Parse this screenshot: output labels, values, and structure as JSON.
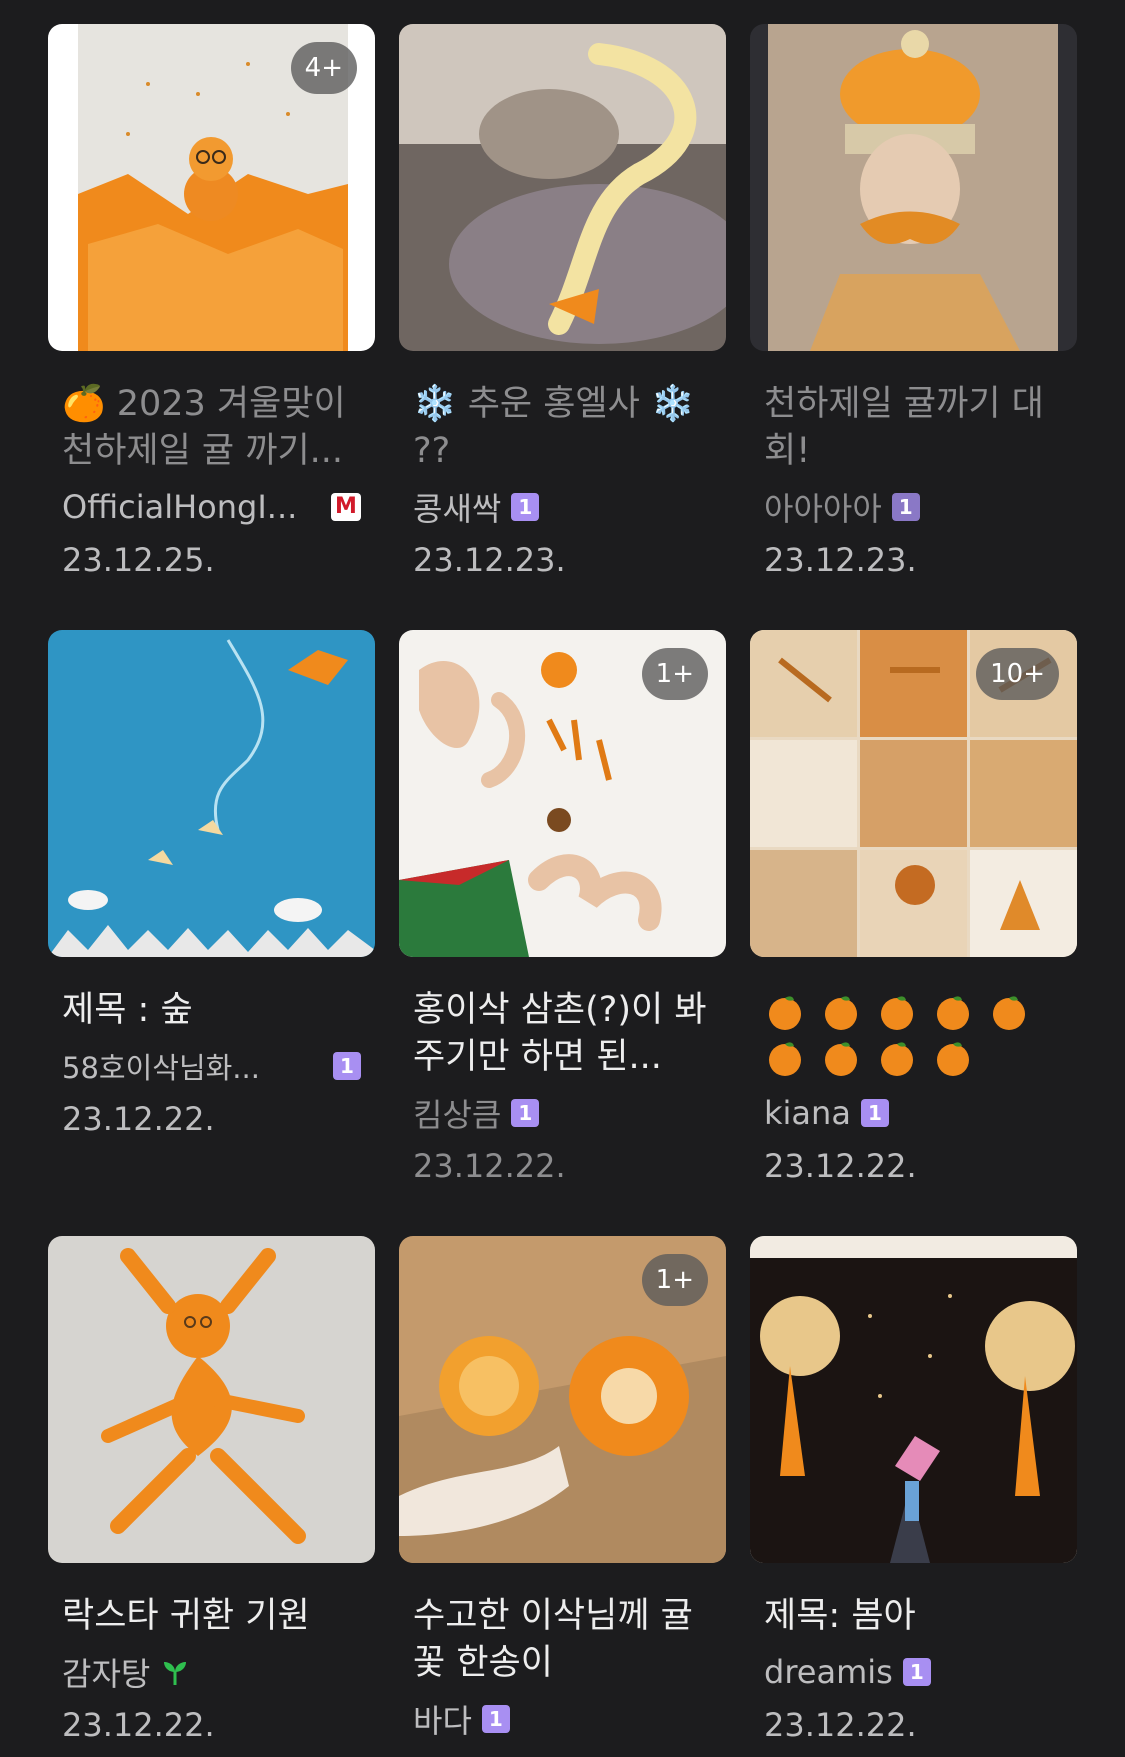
{
  "posts": [
    {
      "title": "🍊 2023 겨울맞이 천하제일 귤 까기...",
      "author": "OfficialHongI...",
      "author_badge": "M",
      "date": "23.12.25.",
      "image_count": "4+",
      "thumbnail": "snowman-orange-peel-icon"
    },
    {
      "title": "❄️ 추운 홍엘사 ❄️ ??",
      "author": "콩새싹",
      "author_badge": "1",
      "date": "23.12.23.",
      "image_count": "",
      "thumbnail": "sleeping-person-peel-icon"
    },
    {
      "title": "천하제일 귤까기 대회!",
      "author": "아아아아",
      "author_badge": "1",
      "date": "23.12.23.",
      "image_count": "",
      "thumbnail": "peel-costume-portrait-icon"
    },
    {
      "title": "제목 : 숲",
      "author": "58호이삭님화...",
      "author_badge": "1",
      "date": "23.12.22.",
      "image_count": "",
      "thumbnail": "blue-forest-painting-icon"
    },
    {
      "title": "홍이삭 삼촌(?)이 봐주기만 하면 된...",
      "author": "킴상큼",
      "author_badge": "1",
      "date": "23.12.22.",
      "image_count": "1+",
      "thumbnail": "hands-heart-peel-icon"
    },
    {
      "title": "🍊🍊🍊🍊🍊🍊🍊🍊🍊",
      "author": "kiana",
      "author_badge": "1",
      "date": "23.12.22.",
      "image_count": "10+",
      "thumbnail": "peel-collage-icon"
    },
    {
      "title": "락스타 귀환 기원",
      "author": "감자탕",
      "author_badge": "sprout",
      "date": "23.12.22.",
      "image_count": "",
      "thumbnail": "dancing-peel-figure-icon"
    },
    {
      "title": "수고한 이삭님께 귤꽃 한송이",
      "author": "바다",
      "author_badge": "1",
      "date": "",
      "image_count": "1+",
      "thumbnail": "orange-flowers-icon"
    },
    {
      "title": "제목: 봄아",
      "author": "dreamis",
      "author_badge": "1",
      "date": "23.12.22.",
      "image_count": "",
      "thumbnail": "night-trees-painting-icon"
    }
  ],
  "colors": {
    "background": "#1c1c1e",
    "level_badge": "#a88ff2",
    "manager_badge": "#d11a2a",
    "sprout": "#2fbf4f",
    "orange": "#f08a1c"
  }
}
